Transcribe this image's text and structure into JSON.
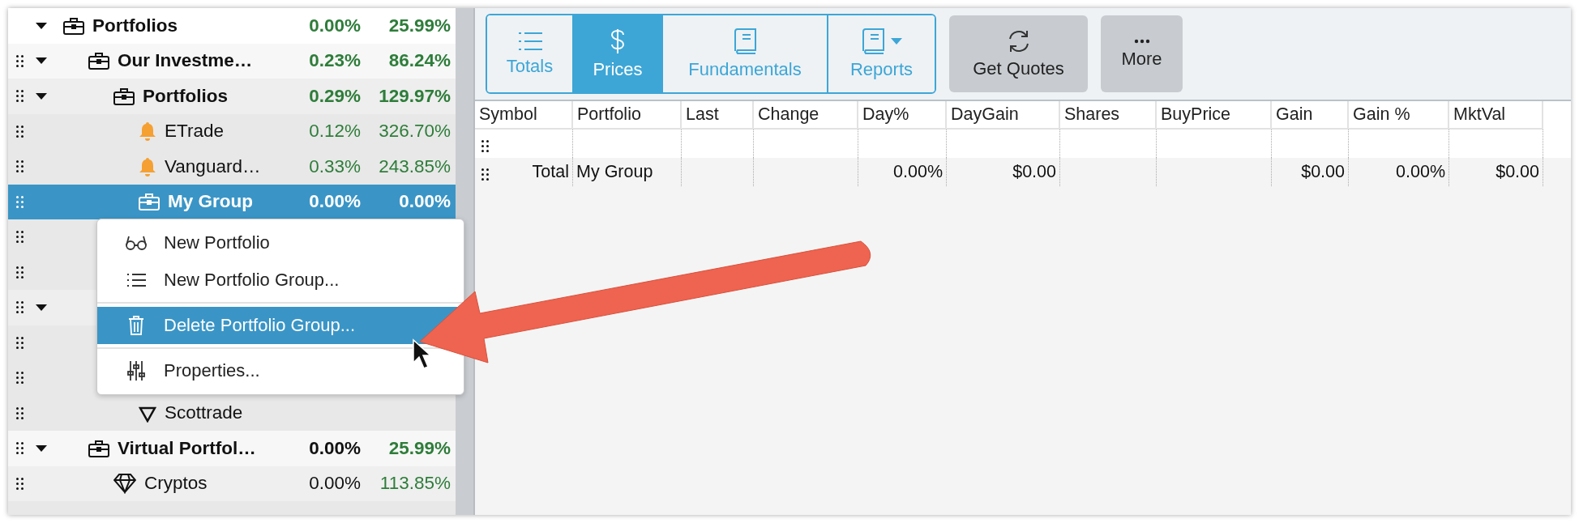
{
  "tree": [
    {
      "kind": "group",
      "name": "Portfolios",
      "expanded": true,
      "draggable": false,
      "day": {
        "text": "0.00%",
        "up": true
      },
      "total": {
        "text": "25.99%",
        "up": true
      },
      "selected": false,
      "children": [
        {
          "kind": "group",
          "name": "Our Investme…",
          "expanded": true,
          "draggable": true,
          "day": {
            "text": "0.23%",
            "up": true
          },
          "total": {
            "text": "86.24%",
            "up": true
          },
          "selected": false,
          "children": [
            {
              "kind": "group",
              "name": "Portfolios",
              "expanded": true,
              "draggable": true,
              "day": {
                "text": "0.29%",
                "up": true
              },
              "total": {
                "text": "129.97%",
                "up": true
              },
              "selected": false,
              "children": [
                {
                  "kind": "alert",
                  "name": "ETrade",
                  "draggable": true,
                  "day": {
                    "text": "0.12%",
                    "up": true
                  },
                  "total": {
                    "text": "326.70%",
                    "up": true
                  },
                  "selected": false
                },
                {
                  "kind": "alert",
                  "name": "Vanguard…",
                  "draggable": true,
                  "day": {
                    "text": "0.33%",
                    "up": true
                  },
                  "total": {
                    "text": "243.85%",
                    "up": true
                  },
                  "selected": false
                },
                {
                  "kind": "group",
                  "name": "My Group",
                  "draggable": true,
                  "day": {
                    "text": "0.00%",
                    "up": true
                  },
                  "total": {
                    "text": "0.00%",
                    "up": true
                  },
                  "selected": true
                },
                {
                  "kind": "hidden",
                  "draggable": true,
                  "selected": false
                },
                {
                  "kind": "hidden",
                  "draggable": true,
                  "selected": false
                }
              ]
            },
            {
              "kind": "hidden",
              "expanded": true,
              "draggable": true,
              "selected": false,
              "children": [
                {
                  "kind": "hidden",
                  "draggable": true,
                  "selected": false
                },
                {
                  "kind": "hidden",
                  "draggable": true,
                  "selected": false
                },
                {
                  "kind": "marker",
                  "name": "Scottrade",
                  "draggable": true,
                  "selected": false
                }
              ]
            }
          ]
        },
        {
          "kind": "group",
          "name": "Virtual Portfol…",
          "expanded": true,
          "draggable": true,
          "day": {
            "text": "0.00%",
            "up": false
          },
          "total": {
            "text": "25.99%",
            "up": true
          },
          "selected": false,
          "children": [
            {
              "kind": "crypto",
              "name": "Cryptos",
              "draggable": true,
              "day": {
                "text": "0.00%",
                "up": false
              },
              "total": {
                "text": "113.85%",
                "up": true
              },
              "selected": false
            }
          ]
        }
      ]
    }
  ],
  "context_menu": {
    "sections": [
      [
        {
          "label": "New Portfolio",
          "selected": false
        },
        {
          "label": "New Portfolio Group...",
          "selected": false
        }
      ],
      [
        {
          "label": "Delete Portfolio Group...",
          "selected": true
        }
      ],
      [
        {
          "label": "Properties...",
          "selected": false
        }
      ]
    ]
  },
  "toolbar": {
    "views": [
      {
        "label": "Totals",
        "selected": false,
        "dropdown": false
      },
      {
        "label": "Prices",
        "selected": true,
        "dropdown": false
      },
      {
        "label": "Fundamentals",
        "selected": false,
        "dropdown": false
      },
      {
        "label": "Reports",
        "selected": false,
        "dropdown": true
      }
    ],
    "buttons": [
      "Get Quotes",
      "More"
    ]
  },
  "table": {
    "columns": [
      "Symbol",
      "Portfolio",
      "Last",
      "Change",
      "Day%",
      "DayGain",
      "Shares",
      "BuyPrice",
      "Gain",
      "Gain %",
      "MktVal"
    ],
    "rows": [
      {
        "draggable": true
      },
      {
        "draggable": true,
        "cells": [
          "Total",
          "My Group",
          null,
          null,
          "0.00%",
          "$0.00",
          null,
          null,
          "$0.00",
          "0.00%",
          "$0.00"
        ]
      }
    ]
  }
}
